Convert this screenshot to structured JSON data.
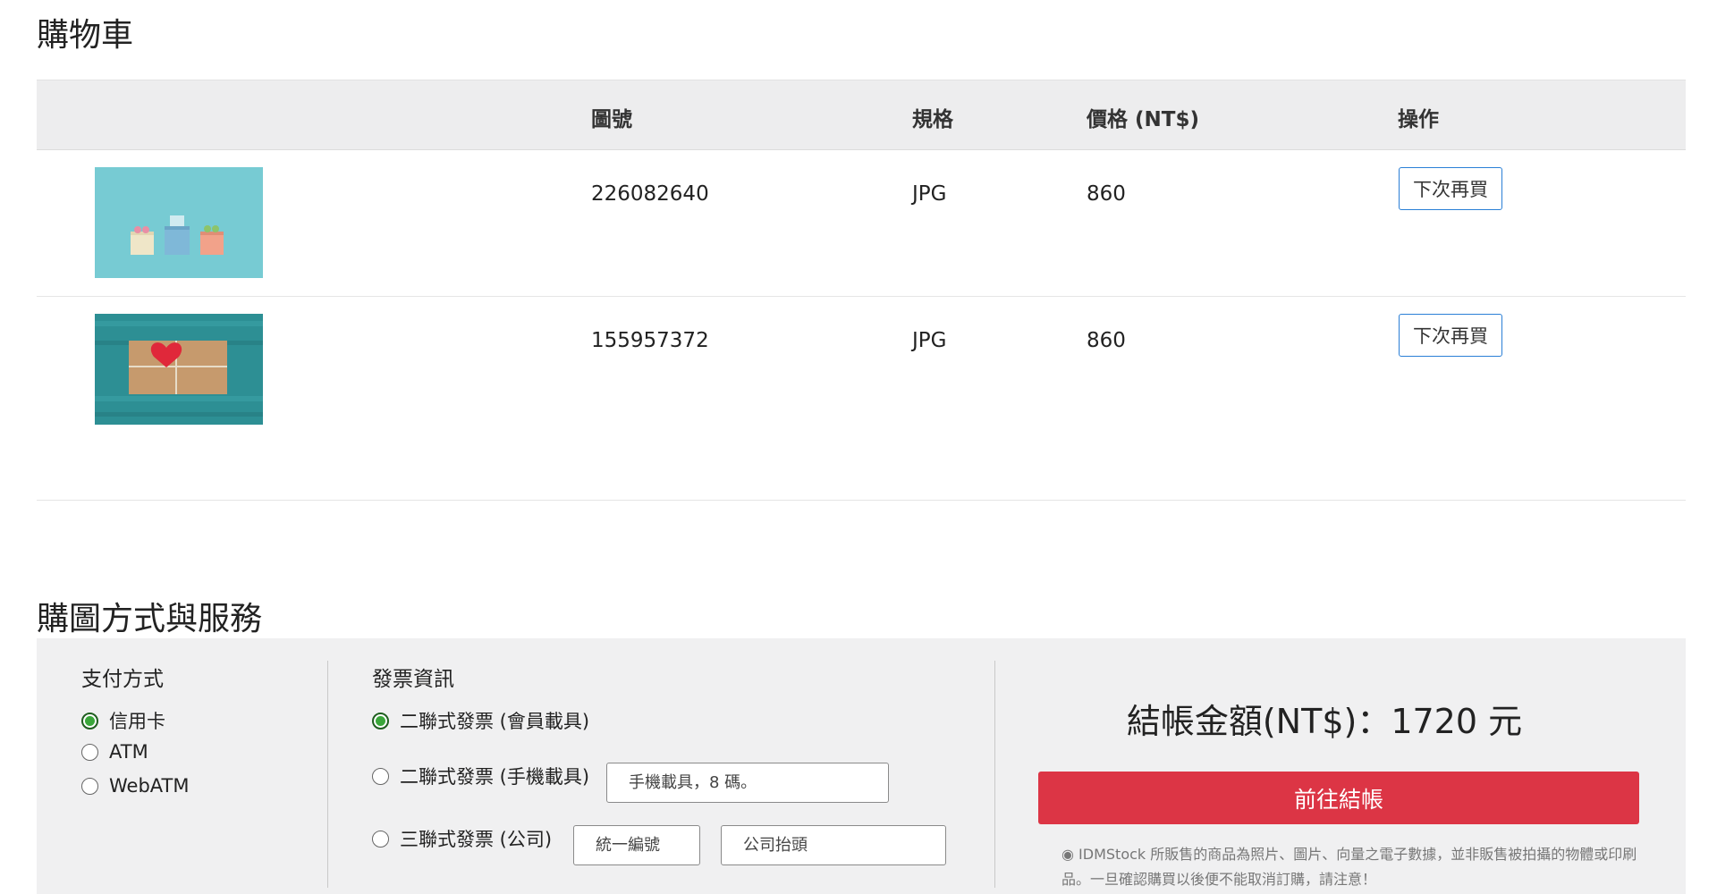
{
  "page": {
    "title": "購物車"
  },
  "cart": {
    "headers": {
      "image": "",
      "id": "圖號",
      "spec": "規格",
      "price": "價格 (NT$)",
      "action": "操作"
    },
    "items": [
      {
        "id": "226082640",
        "spec": "JPG",
        "price": "860",
        "action": "下次再買"
      },
      {
        "id": "155957372",
        "spec": "JPG",
        "price": "860",
        "action": "下次再買"
      }
    ]
  },
  "service": {
    "title": "購圖方式與服務",
    "payment": {
      "title": "支付方式",
      "options": [
        {
          "label": "信用卡",
          "checked": true
        },
        {
          "label": "ATM",
          "checked": false
        },
        {
          "label": "WebATM",
          "checked": false
        }
      ]
    },
    "invoice": {
      "title": "發票資訊",
      "options": [
        {
          "label": "二聯式發票 (會員載具)",
          "checked": true
        },
        {
          "label": "二聯式發票 (手機載具)",
          "checked": false
        },
        {
          "label": "三聯式發票 (公司)",
          "checked": false
        }
      ],
      "mobile_carrier_placeholder": "手機載具，8 碼。",
      "tax_id_placeholder": "統一編號",
      "company_title_placeholder": "公司抬頭"
    },
    "summary": {
      "total_label": "結帳金額(NT$)：1720 元",
      "checkout_label": "前往結帳",
      "notice": "◉ IDMStock 所販售的商品為照片、圖片、向量之電子數據，並非販售被拍攝的物體或印刷品。一旦確認購買以後便不能取消訂購，請注意！"
    },
    "colors": {
      "checkout": "#dc3545",
      "button_border": "#2a7fd6",
      "radio_checked": "#3aa63a"
    }
  }
}
